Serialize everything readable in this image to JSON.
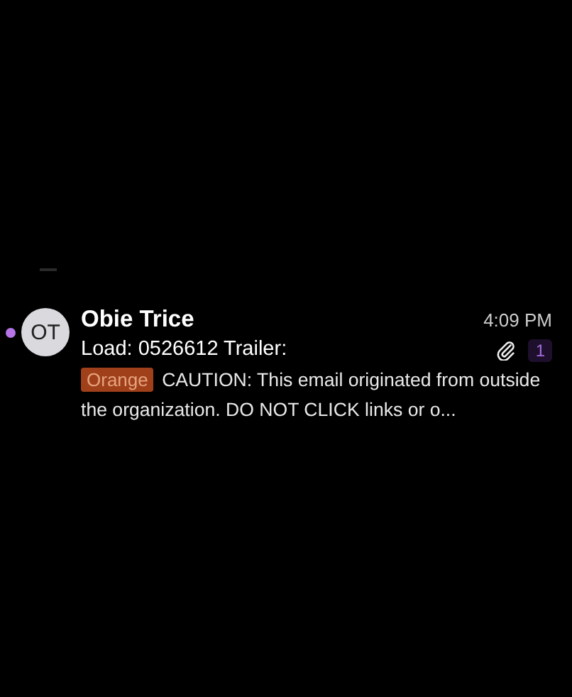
{
  "messages": [
    {
      "unread": true,
      "initials": "OT",
      "sender": "Obie Trice",
      "time": "4:09 PM",
      "subject": "Load: 0526612 Trailer:",
      "attachment": true,
      "count": "1",
      "tag": {
        "label": "Orange",
        "color": "#a0401a"
      },
      "preview": "CAUTION: This email originated from outside the organization. DO NOT CLICK links or o..."
    }
  ]
}
